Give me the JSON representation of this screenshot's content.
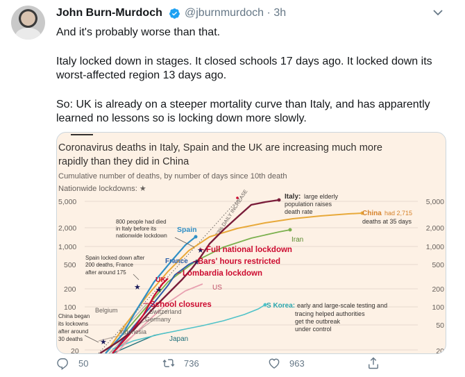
{
  "tweet": {
    "author_name": "John Burn-Murdoch",
    "handle": "@jburnmurdoch",
    "separator": "·",
    "time": "3h",
    "paragraphs": [
      "And it's probably worse than that.",
      "Italy locked down in stages. It closed schools 17 days ago. It locked down its worst-affected region 13 days ago.",
      "So: UK is already on a steeper mortality curve than Italy, and has apparently learned no lessons so is locking down more slowly."
    ]
  },
  "actions": {
    "reply_count": "50",
    "retweet_count": "736",
    "like_count": "963"
  },
  "icons": [
    "verified-icon",
    "chevron-down-icon",
    "reply-icon",
    "retweet-icon",
    "like-icon",
    "share-icon"
  ],
  "colors": {
    "chart_bg": "#fdf1e5",
    "italy": "#7a1d3a",
    "spain": "#2f8fc5",
    "uk": "#cc0a2f",
    "china": "#e8a93a",
    "iran": "#7bb04e",
    "france": "#2c5ea8",
    "us": "#e8a0b0",
    "south_korea": "#4fc2c8",
    "japan": "#1e6f7a"
  },
  "chart": {
    "title_line1": "Coronavirus deaths in Italy, Spain and the UK are increasing much more",
    "title_line2": "rapidly than they did in China",
    "subtitle": "Cumulative number of deaths, by number of days since 10th death",
    "lockdowns_note": "Nationwide lockdowns: ★",
    "y_ticks_left": [
      "5,000",
      "2,000",
      "1,000",
      "500",
      "200",
      "100",
      "20"
    ],
    "y_ticks_right": [
      "5,000",
      "2,000",
      "1,000",
      "500",
      "200",
      "100",
      "50",
      "20"
    ],
    "annotations": {
      "italy_label": "Italy:",
      "italy_note_1": "large elderly",
      "italy_note_2": "population raises",
      "italy_note_3": "death rate",
      "china_label": "China",
      "china_note_1": "had 2,715",
      "china_note_2": "deaths at 35 days",
      "iran": "Iran",
      "spain": "Spain",
      "france": "France",
      "uk": "UK",
      "us": "US",
      "belgium": "Belgium",
      "germany": "Germany",
      "switzerland": "Switzerland",
      "indonesia": "Indonesia",
      "japan": "Japan",
      "skorea_label": "S Korea:",
      "skorea_note_1": "early and large-scale testing and",
      "skorea_note_2": "tracing helped authorities",
      "skorea_note_3": "get the outbreak",
      "skorea_note_4": "under control",
      "doubling": "33% DAILY INCREASE",
      "full_lockdown": "Full national lockdown",
      "bars_restricted": "Bars' hours restricted",
      "lombardia": "Lombardia lockdown",
      "school": "School closures",
      "italy800_1": "800 people had died",
      "italy800_2": "in Italy before its",
      "italy800_3": "nationwide lockdown",
      "spain200_1": "Spain locked down after",
      "spain200_2": "200 deaths, France",
      "spain200_3": "after around 175",
      "china_began_1": "China began",
      "china_began_2": "its lockowns",
      "china_began_3": "after around",
      "china_began_4": "30 deaths"
    }
  }
}
